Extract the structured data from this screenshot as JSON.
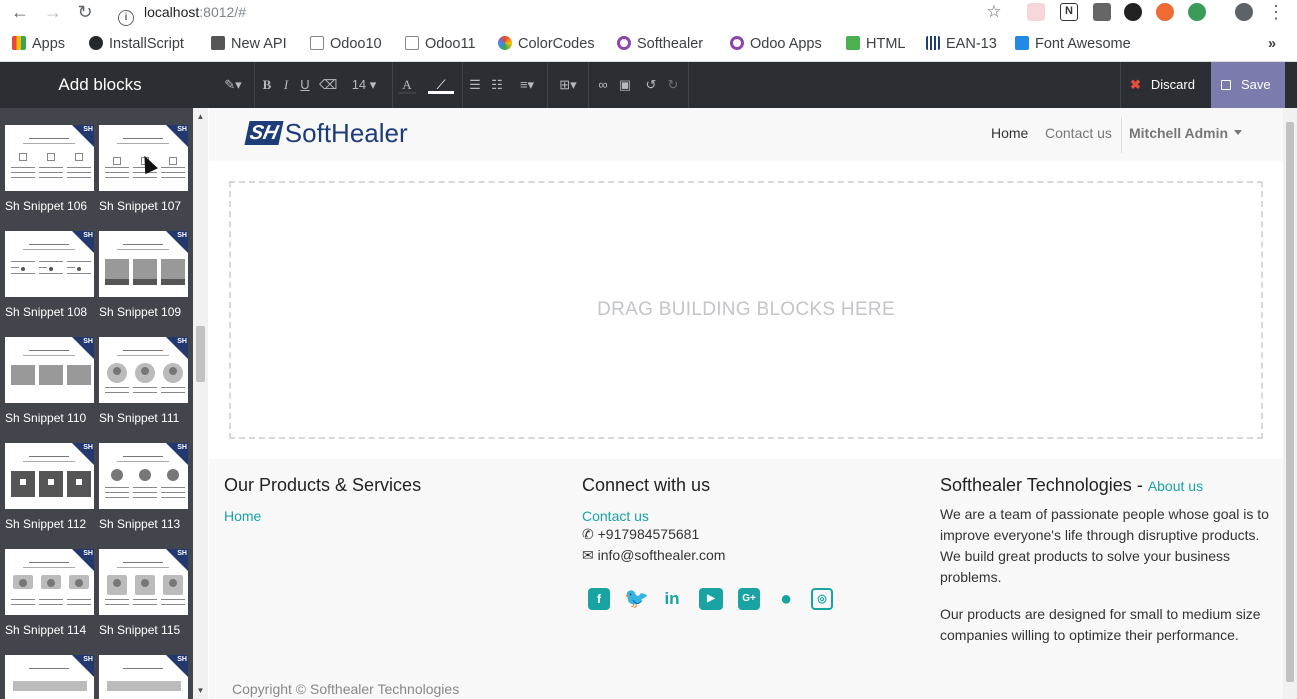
{
  "browser": {
    "url_host": "localhost",
    "url_rest": ":8012/#",
    "bookmarks": [
      {
        "label": "Apps",
        "color": "#e8453c"
      },
      {
        "label": "InstallScript",
        "color": "#24292e"
      },
      {
        "label": "New API",
        "color": "#555"
      },
      {
        "label": "Odoo10",
        "color": "#888"
      },
      {
        "label": "Odoo11",
        "color": "#888"
      },
      {
        "label": "ColorCodes",
        "color": "#4285f4"
      },
      {
        "label": "Softhealer",
        "color": "#8e44ad"
      },
      {
        "label": "Odoo Apps",
        "color": "#8e44ad"
      },
      {
        "label": "HTML",
        "color": "#4caf50"
      },
      {
        "label": "EAN-13",
        "color": "#1e3c78"
      },
      {
        "label": "Font Awesome",
        "color": "#228ae6"
      }
    ],
    "more": "»"
  },
  "sidebar": {
    "title": "Add blocks",
    "badge": "SH",
    "snippets": [
      {
        "label": "Sh Snippet 106"
      },
      {
        "label": "Sh Snippet 107"
      },
      {
        "label": "Sh Snippet 108"
      },
      {
        "label": "Sh Snippet 109"
      },
      {
        "label": "Sh Snippet 110"
      },
      {
        "label": "Sh Snippet 111"
      },
      {
        "label": "Sh Snippet 112"
      },
      {
        "label": "Sh Snippet 113"
      },
      {
        "label": "Sh Snippet 114"
      },
      {
        "label": "Sh Snippet 115"
      }
    ]
  },
  "toolbar": {
    "font_size": "14",
    "discard_label": "Discard",
    "save_label": "Save"
  },
  "site": {
    "logo_mark": "SH",
    "logo_text": "SoftHealer",
    "menu": {
      "home": "Home",
      "contact": "Contact us",
      "user": "Mitchell Admin"
    },
    "dropzone_text": "DRAG BUILDING BLOCKS HERE"
  },
  "footer": {
    "products": {
      "title": "Our Products & Services",
      "link": "Home"
    },
    "connect": {
      "title": "Connect with us",
      "link": "Contact us",
      "phone": "+917984575681",
      "email": "info@softhealer.com"
    },
    "about": {
      "title": "Softhealer Technologies",
      "dash": " - ",
      "link": "About us",
      "p1": "We are a team of passionate people whose goal is to improve everyone's life through disruptive products. We build great products to solve your business problems.",
      "p2": "Our products are designed for small to medium size companies willing to optimize their performance."
    },
    "social": [
      "facebook-icon",
      "twitter-icon",
      "linkedin-icon",
      "youtube-icon",
      "google-plus-icon",
      "github-icon",
      "instagram-icon"
    ],
    "copyright": "Copyright © Softhealer Technologies"
  },
  "colors": {
    "accent": "#1aa3a3",
    "save_bg": "#7c7bad",
    "toolbar_bg": "#2b2e33",
    "brand": "#1e3c78"
  }
}
